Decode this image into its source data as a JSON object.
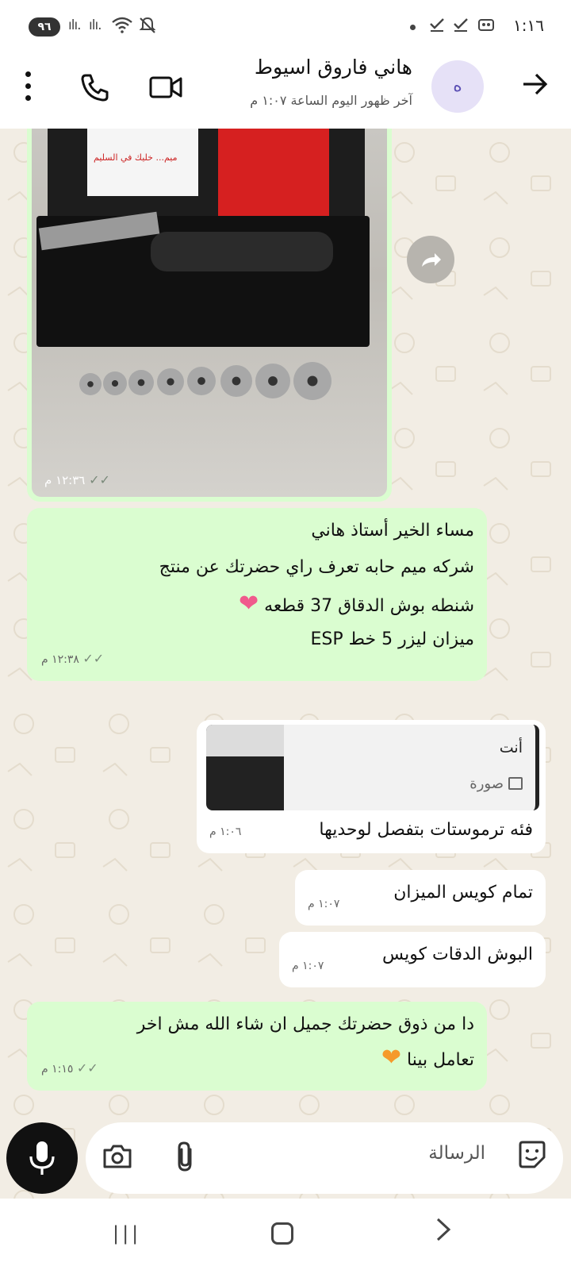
{
  "status_bar": {
    "time": "١:١٦",
    "battery": "٩٦"
  },
  "header": {
    "contact_name": "هاني فاروق اسيوط",
    "last_seen": "آخر ظهور اليوم الساعة ١:٠٧ م",
    "avatar_letter": "ه"
  },
  "messages": {
    "photo": {
      "time": "١٢:٣٦ م",
      "paper_text": "ميم... خليك في السليم"
    },
    "msg1": {
      "lines": [
        "مساء الخير أستاذ هاني",
        "شركه ميم حابه تعرف راي حضرتك عن منتج",
        "شنطه بوش الدقاق 37 قطعه",
        "ميزان ليزر 5 خط ESP"
      ],
      "emoji": "❤",
      "time": "١٢:٣٨ م"
    },
    "reply1": {
      "quote_author": "أنت",
      "quote_type": "صورة",
      "text": "فئه ترموستات بتفصل لوحديها",
      "time": "١:٠٦ م"
    },
    "reply2": {
      "text": "تمام كويس الميزان",
      "time": "١:٠٧ م"
    },
    "reply3": {
      "text": "البوش الدقات كويس",
      "time": "١:٠٧ م"
    },
    "msg2": {
      "lines": [
        "دا من ذوق حضرتك جميل ان شاء الله مش اخر",
        "تعامل بينا"
      ],
      "emoji": "❤",
      "time": "١:١٥ م"
    }
  },
  "composer": {
    "placeholder": "الرسالة"
  }
}
